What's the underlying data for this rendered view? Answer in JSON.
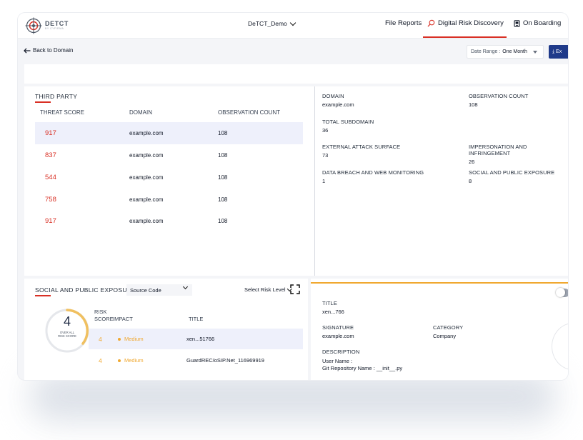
{
  "app": {
    "logo_text": "DETCT",
    "logo_subtext": "BY CYFIRMA",
    "org_name": "DeTCT_Demo",
    "nav": [
      {
        "label": "File Reports",
        "icon": ""
      },
      {
        "label": "Digital Risk Discovery",
        "icon": "search-icon"
      },
      {
        "label": "On Boarding",
        "icon": "device-icon"
      }
    ],
    "active_nav": "Digital Risk Discovery",
    "accent_color": "#d93025",
    "score_color": "#f0a830",
    "primary_color": "#1f3a8a"
  },
  "subheader": {
    "back_label": "Back to Domain",
    "date_range_label": "Date Range :",
    "date_range_value": "One Month",
    "export_label": "⤓ Ex"
  },
  "third_party": {
    "title": "THIRD PARTY",
    "columns": [
      "THREAT SCORE",
      "DOMAIN",
      "OBSERVATION COUNT"
    ],
    "rows": [
      {
        "score": "917",
        "domain": "example.com",
        "count": "108"
      },
      {
        "score": "837",
        "domain": "example.com",
        "count": "108"
      },
      {
        "score": "544",
        "domain": "example.com",
        "count": "108"
      },
      {
        "score": "758",
        "domain": "example.com",
        "count": "108"
      },
      {
        "score": "917",
        "domain": "example.com",
        "count": "108"
      }
    ]
  },
  "details": {
    "domain": {
      "label": "DOMAIN",
      "value": "example.com"
    },
    "observation_count": {
      "label": "OBSERVATION COUNT",
      "value": "108"
    },
    "total_subdomain": {
      "label": "TOTAL SUBDOMAIN",
      "value": "36"
    },
    "external_attack_surface": {
      "label": "EXTERNAL ATTACK SURFACE",
      "value": "73"
    },
    "impersonation": {
      "label": "IMPERSONATION AND INFRINGEMENT",
      "value": "26"
    },
    "data_breach": {
      "label": "DATA BREACH AND WEB MONITORING",
      "value": "1"
    },
    "social_exposure": {
      "label": "SOCIAL AND PUBLIC EXPOSURE",
      "value": "8"
    }
  },
  "social_public": {
    "title": "SOCIAL AND PUBLIC EXPOSURE",
    "source_select": "Source Code",
    "risk_level_placeholder": "Select Risk Level",
    "overall_score": "4",
    "overall_label_1": "OVER ALL",
    "overall_label_2": "RISK SCORE",
    "columns": {
      "risk_1": "RISK",
      "risk_2": "SCORE",
      "impact": "IMPACT",
      "title": "TITLE"
    },
    "rows": [
      {
        "score": "4",
        "impact": "Medium",
        "title": "xen...51766"
      },
      {
        "score": "4",
        "impact": "Medium",
        "title": "GuardREC/oSIP.Net_116969919"
      }
    ]
  },
  "detail_panel": {
    "title_label": "TITLE",
    "title_value": "xen...766",
    "signature_label": "SIGNATURE",
    "signature_value": "example.com",
    "category_label": "CATEGORY",
    "category_value": "Company",
    "description_label": "DESCRIPTION",
    "description_lines": [
      "User Name :",
      "Git Repository Name : __init__.py"
    ]
  }
}
